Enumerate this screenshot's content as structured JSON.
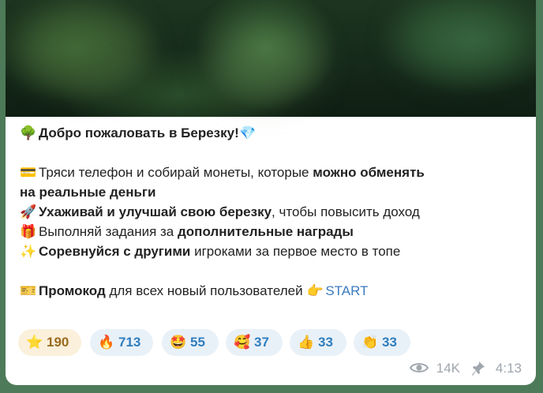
{
  "post": {
    "title": {
      "icon": "🌳",
      "text": "Добро пожаловать в Березку!",
      "icon_end": "💎"
    },
    "line1": {
      "icon": "💳",
      "plain": "Тряси телефон и собирай монеты, которые ",
      "bold": "можно обменять"
    },
    "line2": {
      "bold": "на реальные деньги"
    },
    "line3": {
      "icon": "🚀",
      "bold": "Ухаживай и улучшай свою березку",
      "plain": ", чтобы повысить доход"
    },
    "line4": {
      "icon": "🎁",
      "plain": "Выполняй задания за ",
      "bold": "дополнительные награды"
    },
    "line5": {
      "icon": "✨",
      "bold": "Соревнуйся с другими",
      "plain": " игроками за первое место в топе"
    },
    "line6": {
      "icon": "🎫",
      "bold": "Промокод",
      "plain": " для всех новый пользователей ",
      "icon2": "👉",
      "link": "START"
    }
  },
  "reactions": [
    {
      "icon": "⭐",
      "count": "190"
    },
    {
      "icon": "🔥",
      "count": "713"
    },
    {
      "icon": "🤩",
      "count": "55"
    },
    {
      "icon": "🥰",
      "count": "37"
    },
    {
      "icon": "👍",
      "count": "33"
    },
    {
      "icon": "👏",
      "count": "33"
    }
  ],
  "meta": {
    "views": "14K",
    "time": "4:13"
  },
  "colors": {
    "accent": "#2f7ebf",
    "link": "#3a7bbf",
    "star_bg": "#fbf0dc",
    "chip_bg": "#e9f1f8",
    "meta": "#a0a6ad"
  }
}
